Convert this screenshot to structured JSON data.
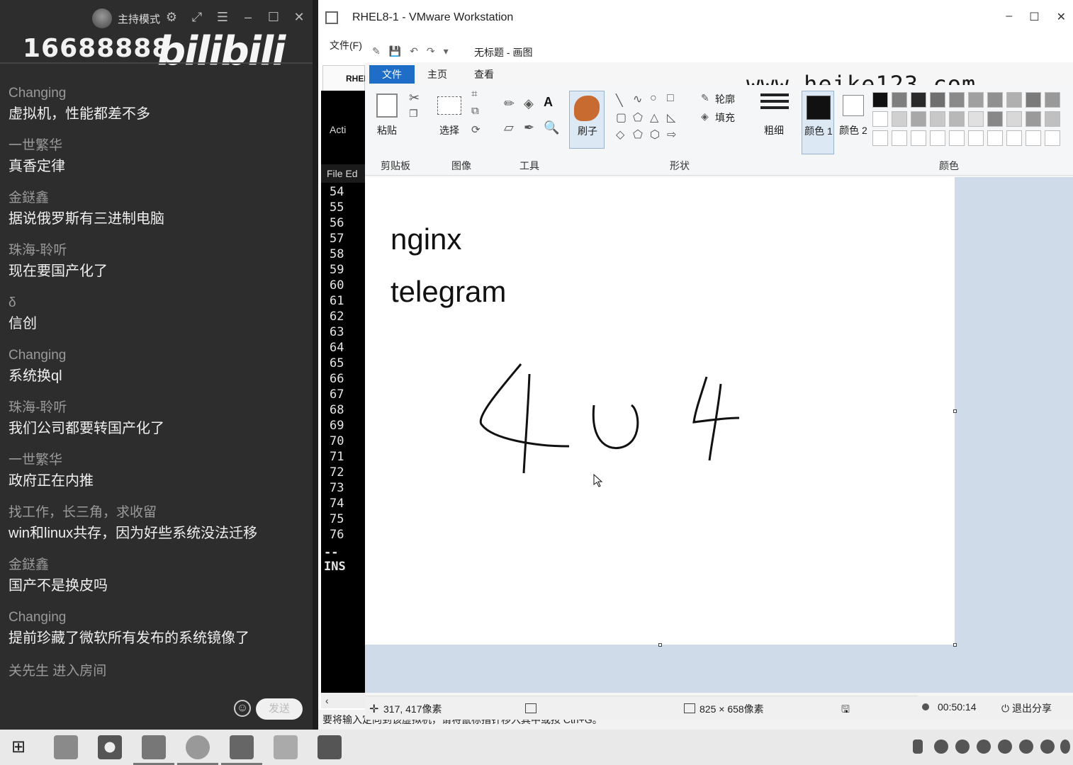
{
  "chat": {
    "host_mode": "主持模式",
    "room_id": "16688888",
    "logo": "bilibili",
    "messages": [
      {
        "name": "Changing",
        "text": "虚拟机，性能都差不多"
      },
      {
        "name": "一世繁华",
        "text": "真香定律"
      },
      {
        "name": "金鎹鑫",
        "text": "据说俄罗斯有三进制电脑"
      },
      {
        "name": "珠海-聆听",
        "text": "现在要国产化了"
      },
      {
        "name": "δ",
        "text": "信创"
      },
      {
        "name": "Changing",
        "text": "系统换ql"
      },
      {
        "name": "珠海-聆听",
        "text": "我们公司都要转国产化了"
      },
      {
        "name": "一世繁华",
        "text": "政府正在内推"
      },
      {
        "name": "找工作，长三角，求收留",
        "text": "win和linux共存，因为好些系统没法迁移"
      },
      {
        "name": "金鎹鑫",
        "text": "国产不是换皮吗"
      },
      {
        "name": "Changing",
        "text": "提前珍藏了微软所有发布的系统镜像了"
      }
    ],
    "enter_notice": "关先生 进入房间",
    "send_label": "发送"
  },
  "vmware": {
    "title": "RHEL8-1 - VMware Workstation",
    "menu_file": "文件(F)",
    "tab_label": "RHEL",
    "terminal_activities": "Acti",
    "terminal_menu": "File  Ed",
    "line_numbers": [
      "54",
      "55",
      "56",
      "57",
      "58",
      "59",
      "60",
      "61",
      "62",
      "63",
      "64",
      "65",
      "66",
      "67",
      "68",
      "69",
      "70",
      "71",
      "72",
      "73",
      "74",
      "75",
      "76"
    ],
    "insert_mode": "-- INS",
    "bottom_hint": "要将输入定向到该虚拟机，请将鼠标指针移入其中或按 Ctrl+G。"
  },
  "paint": {
    "window_title": "无标题 - 画图",
    "watermark": "www.heike123.com",
    "tabs": {
      "file": "文件",
      "home": "主页",
      "view": "查看"
    },
    "tools": {
      "paste": "粘贴",
      "select": "选择",
      "brush": "刷子",
      "outline": "轮廓",
      "fill": "填充",
      "size": "粗细",
      "color1": "颜色 1",
      "color2": "颜色 2"
    },
    "groups": {
      "clipboard": "剪贴板",
      "image": "图像",
      "tools": "工具",
      "shapes": "形状",
      "colors": "颜色"
    },
    "canvas_text_1": "nginx",
    "canvas_text_2": "telegram",
    "drawn_number": "404",
    "status": {
      "cursor_pos": "317, 417像素",
      "canvas_size": "825 × 658像素"
    }
  },
  "recording": {
    "timer": "00:50:14",
    "exit_share": "退出分享"
  },
  "colors": {
    "palette": [
      "#111111",
      "#7f7f7f",
      "#2a2a2a",
      "#6f6f6f",
      "#8a8a8a",
      "#a0a0a0",
      "#909090",
      "#b0b0b0",
      "#7a7a7a",
      "#999999",
      "#ffffff",
      "#d0d0d0",
      "#a8a8a8",
      "#c8c8c8",
      "#b8b8b8",
      "#e0e0e0",
      "#888888",
      "#d8d8d8",
      "#9a9a9a",
      "#c0c0c0",
      "#ffffff",
      "#ffffff",
      "#ffffff",
      "#ffffff",
      "#ffffff",
      "#ffffff",
      "#ffffff",
      "#ffffff",
      "#ffffff",
      "#ffffff"
    ]
  }
}
